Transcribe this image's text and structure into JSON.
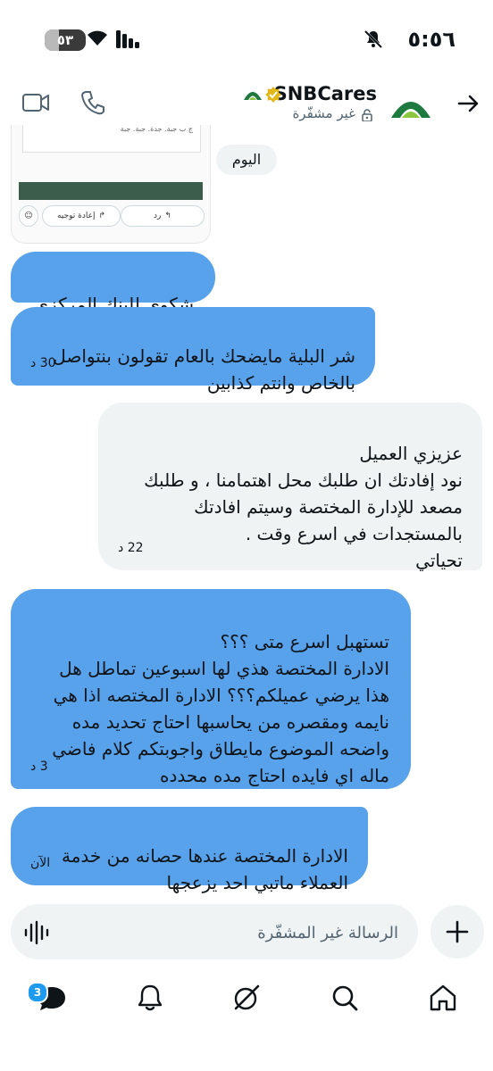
{
  "status_bar": {
    "time": "٥:٥٦",
    "battery": "٥٣"
  },
  "header": {
    "name": "SNBCares",
    "subtitle": "غير مشفّرة"
  },
  "attachment_card": {
    "reply_label": "رد",
    "forward_label": "إعادة توجيه",
    "snippet": "ج ب جبة. جدة. جبة. جبة"
  },
  "date_chip": "اليوم",
  "messages": [
    {
      "direction": "outgoing",
      "text": "شكوى للبنك المركزي",
      "time": ""
    },
    {
      "direction": "outgoing",
      "text": "شر البلية مايضحك بالعام تقولون بنتواصل\nبالخاص وانتم كذابين",
      "time": "30 د"
    },
    {
      "direction": "incoming",
      "text": "عزيزي العميل\nنود إفادتك ان طلبك محل اهتمامنا ، و طلبك\nمصعد للإدارة المختصة وسيتم افادتك\nبالمستجدات في اسرع وقت .\nتحياتي",
      "time": "22 د"
    },
    {
      "direction": "outgoing",
      "text": "تستهبل اسرع متى ؟؟؟\nالادارة المختصة هذي لها اسبوعين تماطل هل\nهذا يرضي عميلكم؟؟؟ الادارة المختصه اذا هي\nنايمه ومقصره من يحاسبها احتاج تحديد مده\nواضحه الموضوع مايطاق واجوبتكم كلام فاضي\nماله اي فايده احتاج مده محدده",
      "time": "3 د"
    },
    {
      "direction": "outgoing",
      "text": "الادارة المختصة عندها حصانه من خدمة\nالعملاء ماتبي احد يزعجها",
      "time": "الآن"
    }
  ],
  "composer": {
    "placeholder": "الرسالة غير المشفّرة"
  },
  "nav": {
    "messages_badge": "3"
  },
  "colors": {
    "outgoing_bubble": "#58a2eb",
    "incoming_bubble": "#eff3f4",
    "accent": "#1d9bf0",
    "snb_green": "#1f7a3f"
  }
}
